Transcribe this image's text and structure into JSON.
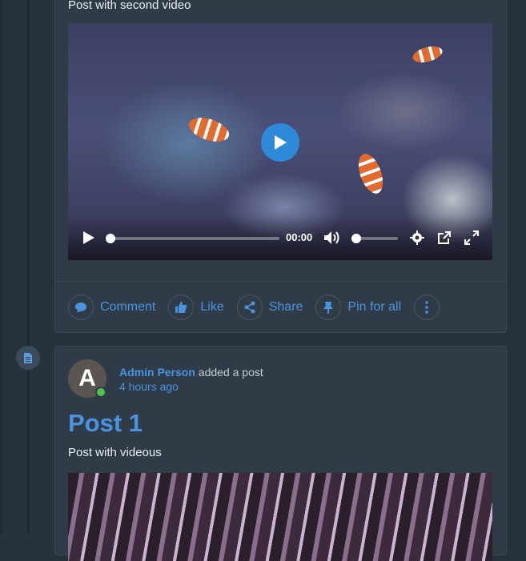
{
  "post_top": {
    "subtitle": "Post with second video",
    "video": {
      "time": "00:00",
      "progress": 0,
      "volume": 0
    },
    "actions": [
      {
        "label": "Comment",
        "icon": "comment-icon"
      },
      {
        "label": "Like",
        "icon": "thumbs-up-icon"
      },
      {
        "label": "Share",
        "icon": "share-icon"
      },
      {
        "label": "Pin for all",
        "icon": "pin-icon"
      },
      {
        "label": "",
        "icon": "more-vertical-icon"
      }
    ]
  },
  "post_bottom": {
    "avatar_letter": "A",
    "author": "Admin Person",
    "action_text": "added a post",
    "time_ago": "4 hours ago",
    "title": "Post 1",
    "body": "Post with videous"
  },
  "colors": {
    "accent": "#4a93e0",
    "background": "#26323c",
    "card": "#2f3c48",
    "online": "#53c24a"
  }
}
